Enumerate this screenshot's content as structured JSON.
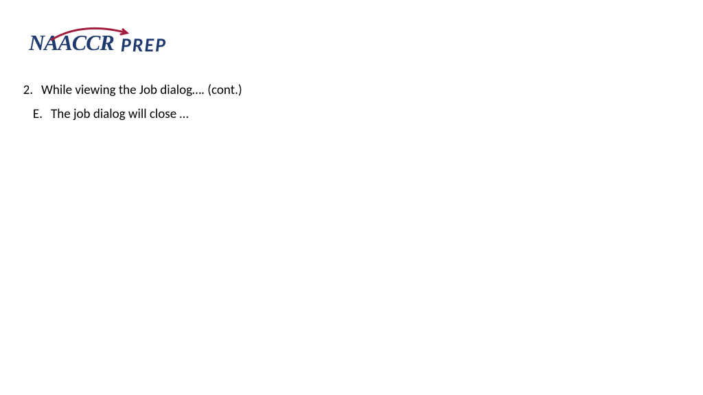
{
  "logo": {
    "brand": "NAACCR",
    "suffix": "PREP"
  },
  "list": {
    "main": {
      "marker": "2.",
      "text": "While viewing the Job dialog…. (cont.)"
    },
    "sub": {
      "marker": "E.",
      "text": "The job dialog will close …"
    }
  }
}
